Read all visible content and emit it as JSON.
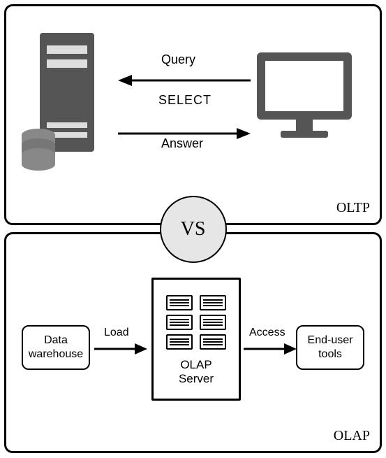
{
  "vs_label": "VS",
  "top": {
    "panel_label": "OLTP",
    "query_label": "Query",
    "select_label": "SELECT",
    "answer_label": "Answer"
  },
  "bottom": {
    "panel_label": "OLAP",
    "data_warehouse_label": "Data\nwarehouse",
    "load_label": "Load",
    "olap_server_label": "OLAP\nServer",
    "access_label": "Access",
    "end_user_label": "End-user\ntools"
  }
}
